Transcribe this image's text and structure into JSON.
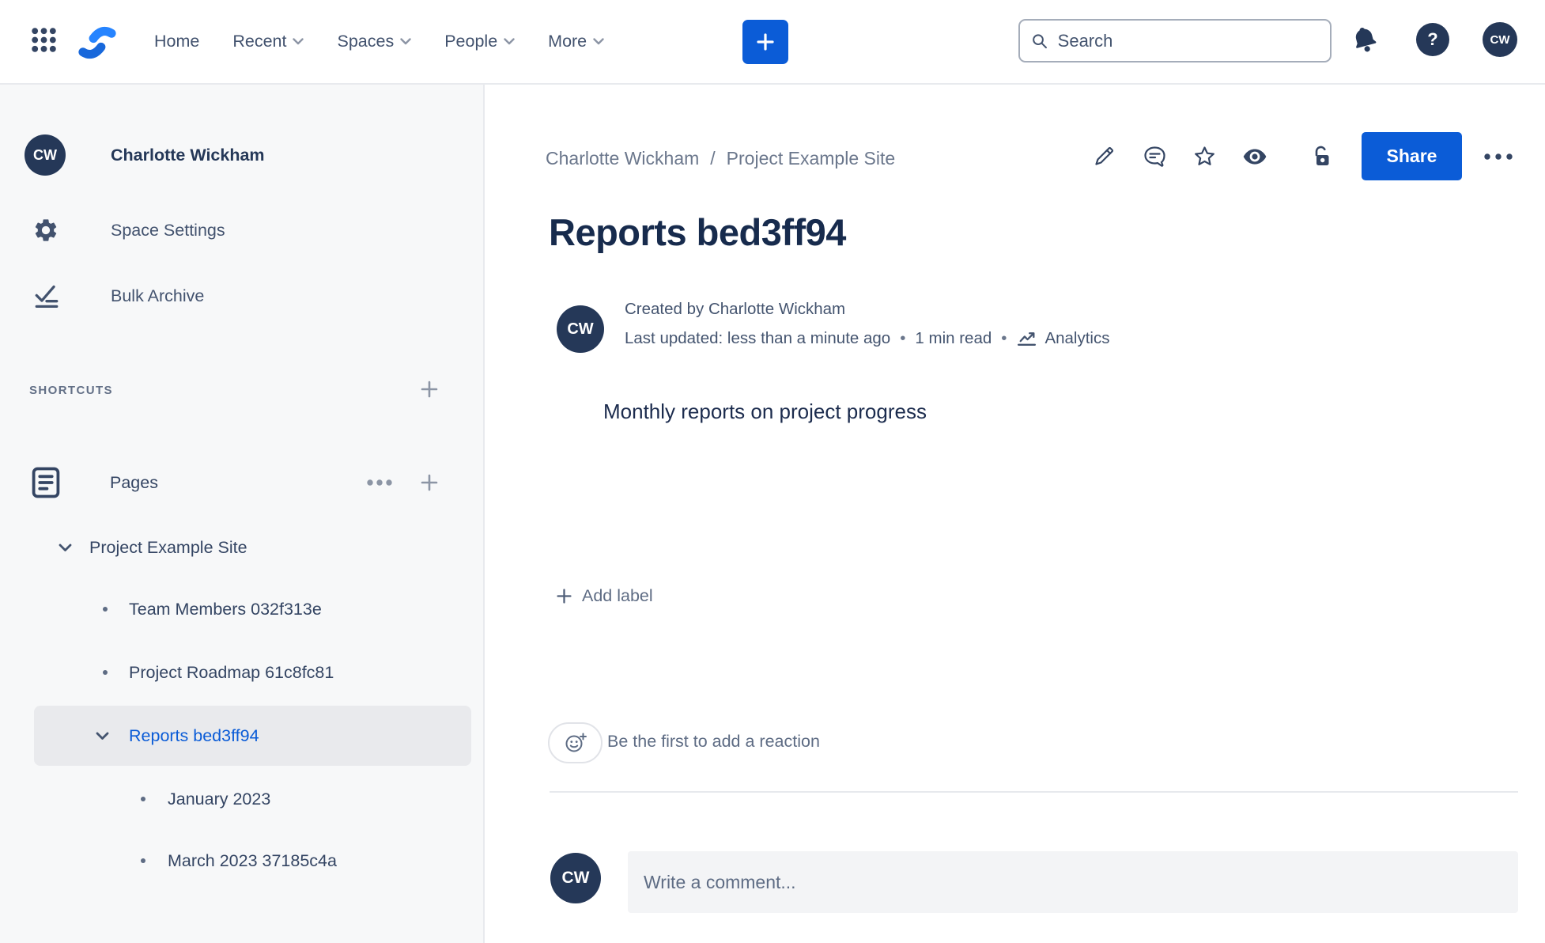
{
  "topnav": {
    "items": [
      {
        "label": "Home",
        "has_menu": false
      },
      {
        "label": "Recent",
        "has_menu": true
      },
      {
        "label": "Spaces",
        "has_menu": true
      },
      {
        "label": "People",
        "has_menu": true
      },
      {
        "label": "More",
        "has_menu": true
      }
    ],
    "search": {
      "placeholder": "Search"
    },
    "help_glyph": "?",
    "profile_initials": "CW"
  },
  "sidebar": {
    "profile": {
      "initials": "CW",
      "name": "Charlotte Wickham"
    },
    "menu": [
      {
        "label": "Space Settings"
      },
      {
        "label": "Bulk Archive"
      }
    ],
    "shortcuts_heading": "SHORTCUTS",
    "pages": {
      "label": "Pages"
    },
    "tree": [
      {
        "label": "Project Example Site",
        "level": 0,
        "expanded": true,
        "selected": false
      },
      {
        "label": "Team Members 032f313e",
        "level": 1,
        "selected": false
      },
      {
        "label": "Project Roadmap 61c8fc81",
        "level": 1,
        "selected": false
      },
      {
        "label": "Reports bed3ff94",
        "level": 1,
        "expanded": true,
        "selected": true
      },
      {
        "label": "January 2023",
        "level": 2,
        "selected": false
      },
      {
        "label": "March 2023 37185c4a",
        "level": 2,
        "selected": false
      }
    ]
  },
  "page_header": {
    "breadcrumb": {
      "items": [
        {
          "label": "Charlotte Wickham"
        },
        {
          "label": "Project Example Site"
        }
      ],
      "separator": "/"
    },
    "share_label": "Share"
  },
  "content": {
    "title": "Reports bed3ff94",
    "byline": {
      "initials": "CW",
      "created_line": "Created by Charlotte Wickham",
      "updated_line": "Last updated: less than a minute ago",
      "read_time": "1 min read",
      "analytics_label": "Analytics",
      "separator": "•"
    },
    "body_text": "Monthly reports on project progress",
    "add_label_text": "Add label",
    "reactions_prompt": "Be the first to add a reaction",
    "comment": {
      "initials": "CW",
      "placeholder": "Write a comment..."
    }
  },
  "icons": {
    "app_grid": "3x3-dots",
    "logo": "confluence-swoosh",
    "settings": "gear",
    "bulk_archive": "checklist",
    "pages": "document-lines",
    "edit": "pencil",
    "comments": "speech-bubble",
    "favourite": "star-outline",
    "watch": "eye-filled",
    "restrictions": "unlocked-padlock",
    "more": "ellipsis",
    "notifications": "bell",
    "help": "question-mark",
    "search": "magnifier",
    "analytics": "line-chart",
    "reaction": "smiley-plus",
    "add": "plus",
    "expand": "chevron-down"
  },
  "colors": {
    "accent_blue": "#0B5CD7",
    "navy": "#253858",
    "text_dark": "#172B4D",
    "text_gray": "#6B778C",
    "sidebar_bg": "#F7F8F9",
    "selected_row_bg": "#E9EAED",
    "comment_box_bg": "#F3F4F6"
  }
}
